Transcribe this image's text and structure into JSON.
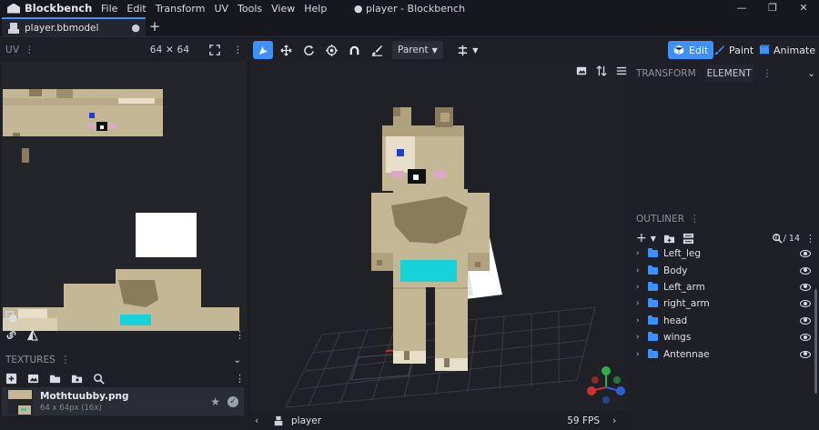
{
  "app": {
    "name": "Blockbench",
    "window_title": "● player - Blockbench",
    "menu": [
      "File",
      "Edit",
      "Transform",
      "UV",
      "Tools",
      "View",
      "Help"
    ],
    "window_controls": [
      "—",
      "❐",
      "✕"
    ]
  },
  "tabs": [
    {
      "label": "player.bbmodel",
      "modified_dot": "●"
    }
  ],
  "tab_add": "+",
  "uv_panel": {
    "title": "UV",
    "size": "64 ✕ 64"
  },
  "toolbar": {
    "parent_select": "Parent"
  },
  "modes": {
    "edit": "Edit",
    "paint": "Paint",
    "animate": "Animate"
  },
  "textures": {
    "title": "TEXTURES",
    "items": [
      {
        "name": "Mothtuubby.png",
        "meta": "64 x 64px (16x)"
      }
    ]
  },
  "right_tabs": {
    "transform": "TRANSFORM",
    "element": "ELEMENT"
  },
  "outliner": {
    "title": "OUTLINER",
    "count": "0 / 14",
    "groups": [
      {
        "name": "Left_leg"
      },
      {
        "name": "Body"
      },
      {
        "name": "Left_arm"
      },
      {
        "name": "right_arm"
      },
      {
        "name": "head"
      },
      {
        "name": "wings"
      },
      {
        "name": "Antennae"
      }
    ]
  },
  "viewport": {
    "model_name": "player",
    "fps": "59 FPS"
  },
  "colors": {
    "accent": "#3e90ff",
    "fur": "#c4b795",
    "dark_fur": "#8a7b5c",
    "cyan": "#17d2d8"
  }
}
